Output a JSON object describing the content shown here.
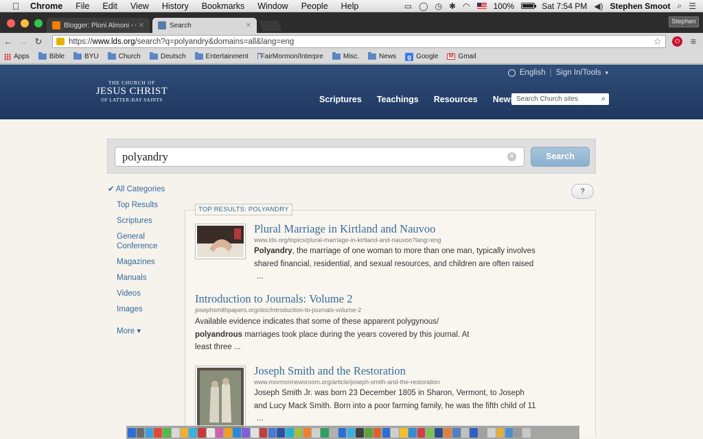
{
  "menubar": {
    "app": "Chrome",
    "items": [
      "File",
      "Edit",
      "View",
      "History",
      "Bookmarks",
      "Window",
      "People",
      "Help"
    ],
    "battery": "100%",
    "clock": "Sat 7:54 PM",
    "user": "Stephen Smoot"
  },
  "tabs": [
    {
      "title": "Blogger: Ploni Almoni - Cr",
      "favicon_color": "#f57d00"
    },
    {
      "title": "Search",
      "favicon_color": "#5a7aa6"
    }
  ],
  "profile": "Stephen",
  "address": {
    "scheme": "https://",
    "host": "www.lds.org",
    "path": "/search?q=polyandry&domains=all&lang=eng"
  },
  "bookmarks": [
    "Apps",
    "Bible",
    "BYU",
    "Church",
    "Deutsch",
    "Entertainment",
    "FairMormon/Interpre",
    "Misc.",
    "News",
    "Google",
    "Gmail"
  ],
  "site": {
    "logo": {
      "line1": "THE CHURCH OF",
      "line2": "JESUS CHRIST",
      "line3": "OF LATTER-DAY SAINTS"
    },
    "language": "English",
    "signin": "Sign In/Tools",
    "nav": [
      "Scriptures",
      "Teachings",
      "Resources",
      "News"
    ],
    "site_search_placeholder": "Search Church sites"
  },
  "search": {
    "query": "polyandry",
    "button": "Search"
  },
  "help_label": "?",
  "sidebar": {
    "categories": [
      "All Categories",
      "Top Results",
      "Scriptures",
      "General Conference",
      "Magazines",
      "Manuals",
      "Videos",
      "Images"
    ],
    "more": "More ▾"
  },
  "top_results_label": "TOP RESULTS: POLYANDRY",
  "results": [
    {
      "title": "Plural Marriage in Kirtland and Nauvoo",
      "url": "www.lds.org/topics/plural-marriage-in-kirtland-and-nauvoo?lang=eng",
      "bold": "Polyandry",
      "snippet1": ", the marriage of one woman to more than one man, typically involves",
      "snippet2": "shared financial, residential, and sexual resources, and children are often raised",
      "snippet3": "..."
    },
    {
      "title": "Introduction to Journals: Volume 2",
      "url": "josephsmithpapers.org/doc/introduction-to-journals-volume-2",
      "snippet1": "Available evidence indicates that some of these apparent polygynous/",
      "bold": "polyandrous",
      "snippet2": " marriages took place during the years covered by this journal. At",
      "snippet3": "least three ..."
    },
    {
      "title": "Joseph Smith and the Restoration",
      "url": "www.mormonnewsroom.org/article/joseph-smith-and-the-restoration",
      "snippet1": "Joseph Smith Jr. was born 23 December 1805 in Sharon, Vermont, to Joseph",
      "snippet2": "and Lucy Mack Smith. Born into a poor farming family, he was the fifth child of 11",
      "snippet3": "..."
    }
  ]
}
